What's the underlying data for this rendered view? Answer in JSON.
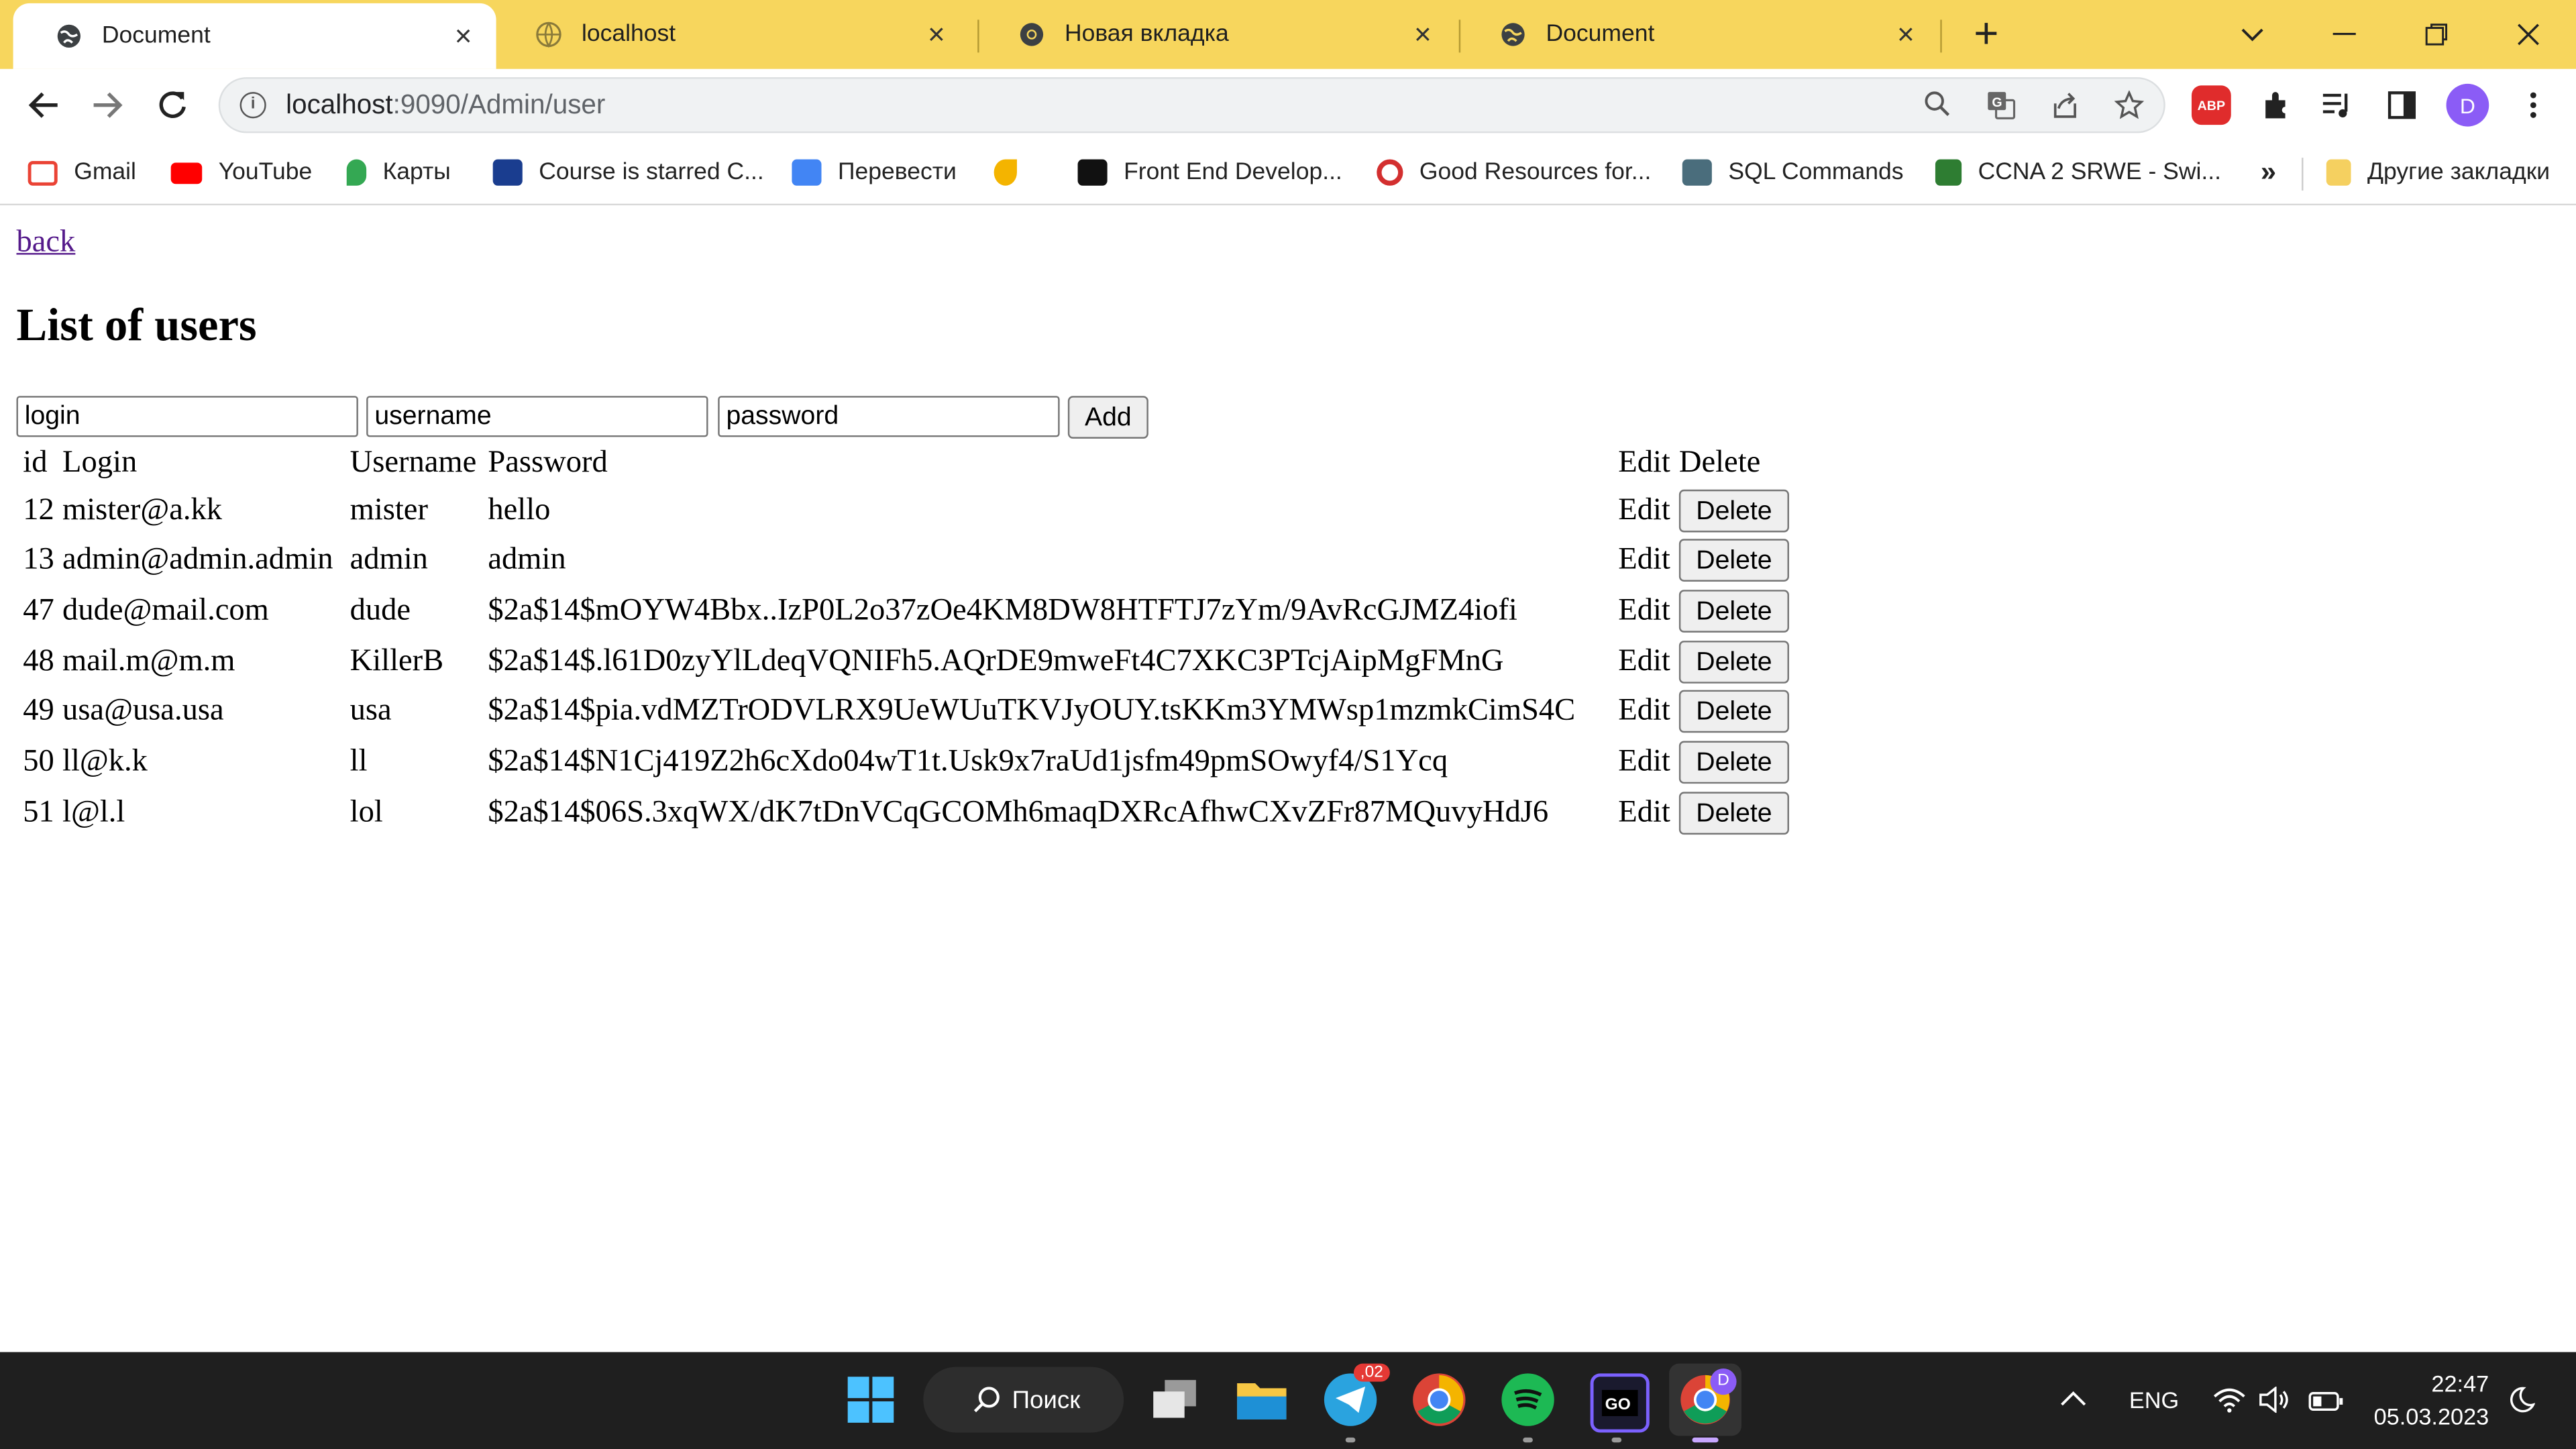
{
  "browser": {
    "tabs": [
      {
        "title": "Document",
        "active": true
      },
      {
        "title": "localhost",
        "active": false
      },
      {
        "title": "Новая вкладка",
        "active": false
      },
      {
        "title": "Document",
        "active": false
      }
    ],
    "url_host": "localhost",
    "url_path": ":9090/Admin/user",
    "bookmarks": [
      {
        "label": "Gmail",
        "color": "#ea4335"
      },
      {
        "label": "YouTube",
        "color": "#ff0000"
      },
      {
        "label": "Карты",
        "color": "#34a853"
      },
      {
        "label": "Course is starred C...",
        "color": "#1a3d8f"
      },
      {
        "label": "Перевести",
        "color": "#4285f4"
      },
      {
        "label": "",
        "color": "#f4b400"
      },
      {
        "label": "Front End Develop...",
        "color": "#111111"
      },
      {
        "label": "Good Resources for...",
        "color": "#d32f2f"
      },
      {
        "label": "SQL Commands",
        "color": "#4a6d7c"
      },
      {
        "label": "CCNA 2 SRWE - Swi...",
        "color": "#2e7d32"
      }
    ],
    "more_bookmarks": "»",
    "other_bookmarks": "Другие закладки",
    "profile_initial": "D",
    "abp_label": "ABP"
  },
  "page": {
    "back_link": "back",
    "heading": "List of users",
    "form": {
      "login_value": "login",
      "username_value": "username",
      "password_value": "password",
      "add_label": "Add"
    },
    "table": {
      "headers": {
        "id": "id",
        "login": "Login",
        "username": "Username",
        "password": "Password",
        "edit": "Edit",
        "delete": "Delete"
      },
      "rows": [
        {
          "id": "12",
          "login": "mister@a.kk",
          "username": "mister",
          "password": "hello",
          "edit": "Edit",
          "delete": "Delete"
        },
        {
          "id": "13",
          "login": "admin@admin.admin",
          "username": "admin",
          "password": "admin",
          "edit": "Edit",
          "delete": "Delete"
        },
        {
          "id": "47",
          "login": "dude@mail.com",
          "username": "dude",
          "password": "$2a$14$mOYW4Bbx..IzP0L2o37zOe4KM8DW8HTFTJ7zYm/9AvRcGJMZ4iofi",
          "edit": "Edit",
          "delete": "Delete"
        },
        {
          "id": "48",
          "login": "mail.m@m.m",
          "username": "KillerB",
          "password": "$2a$14$.l61D0zyYlLdeqVQNIFh5.AQrDE9mweFt4C7XKC3PTcjAipMgFMnG",
          "edit": "Edit",
          "delete": "Delete"
        },
        {
          "id": "49",
          "login": "usa@usa.usa",
          "username": "usa",
          "password": "$2a$14$pia.vdMZTrODVLRX9UeWUuTKVJyOUY.tsKKm3YMWsp1mzmkCimS4C",
          "edit": "Edit",
          "delete": "Delete"
        },
        {
          "id": "50",
          "login": "ll@k.k",
          "username": "ll",
          "password": "$2a$14$N1Cj419Z2h6cXdo04wT1t.Usk9x7raUd1jsfm49pmSOwyf4/S1Ycq",
          "edit": "Edit",
          "delete": "Delete"
        },
        {
          "id": "51",
          "login": "l@l.l",
          "username": "lol",
          "password": "$2a$14$06S.3xqWX/dK7tDnVCqGCOMh6maqDXRcAfhwCXvZFr87MQuvyHdJ6",
          "edit": "Edit",
          "delete": "Delete"
        }
      ]
    }
  },
  "taskbar": {
    "search_label": "Поиск",
    "telegram_badge": ",02",
    "language": "ENG",
    "time": "22:47",
    "date": "05.03.2023"
  }
}
